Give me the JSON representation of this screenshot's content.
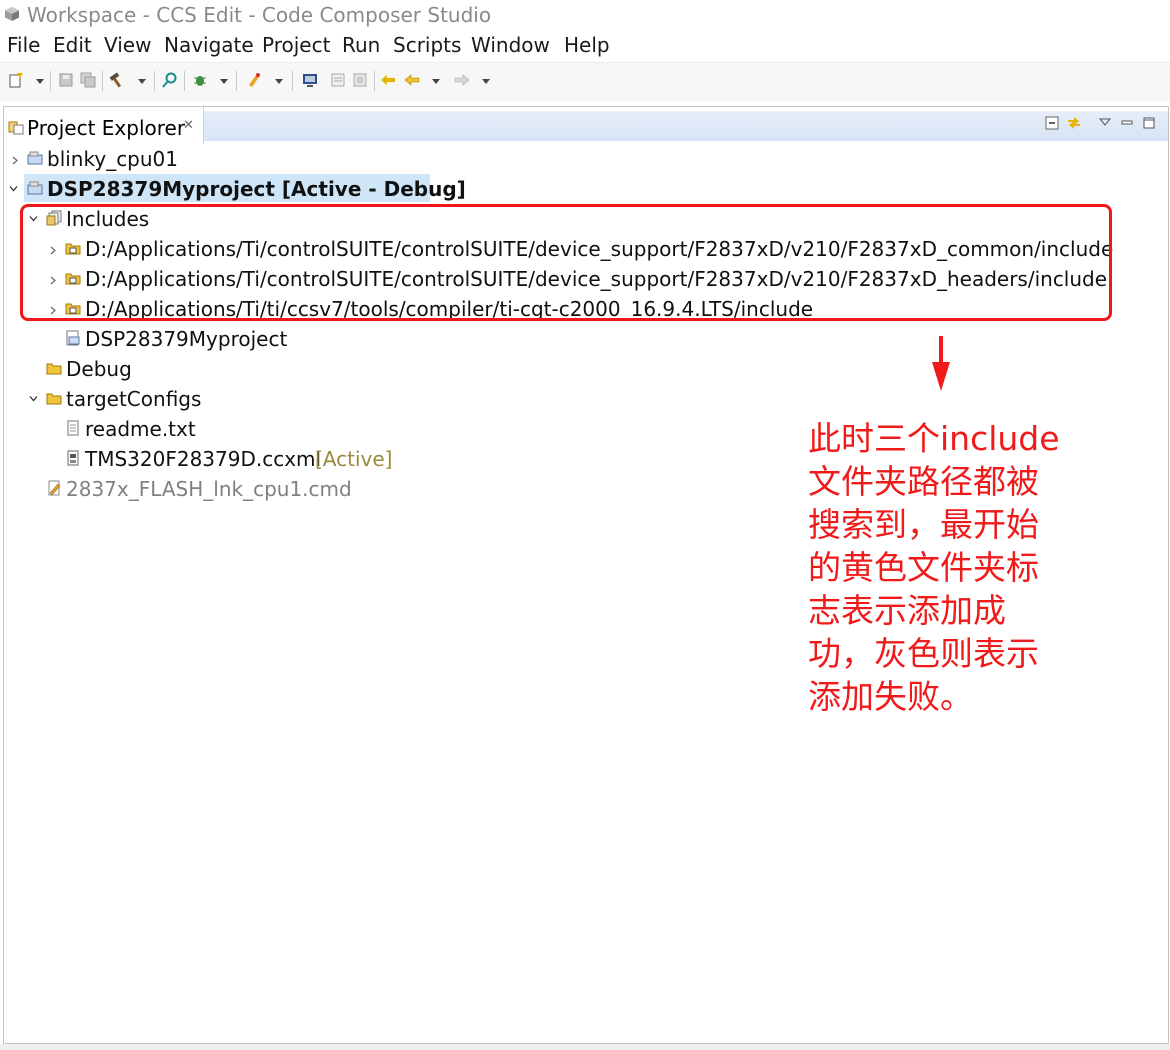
{
  "window": {
    "title": "Workspace - CCS Edit - Code Composer Studio"
  },
  "menubar": {
    "items": [
      "File",
      "Edit",
      "View",
      "Navigate",
      "Project",
      "Run",
      "Scripts",
      "Window",
      "Help"
    ]
  },
  "panel": {
    "tab_label": "Project Explorer",
    "close_glyph": "✕"
  },
  "tree": {
    "blinky": "blinky_cpu01",
    "project": "DSP28379Myproject  [Active - Debug]",
    "includes": "Includes",
    "include_paths": [
      "D:/Applications/Ti/controlSUITE/controlSUITE/device_support/F2837xD/v210/F2837xD_common/include",
      "D:/Applications/Ti/controlSUITE/controlSUITE/device_support/F2837xD/v210/F2837xD_headers/include",
      "D:/Applications/Ti/ti/ccsv7/tools/compiler/ti-cgt-c2000_16.9.4.LTS/include"
    ],
    "binary": "DSP28379Myproject",
    "debug": "Debug",
    "target_configs": "targetConfigs",
    "readme": "readme.txt",
    "ccxml": "TMS320F28379D.ccxml",
    "ccxml_status": "[Active]",
    "cmd": "2837x_FLASH_lnk_cpu1.cmd"
  },
  "annotation": {
    "lines": [
      "此时三个include",
      "文件夹路径都被",
      "搜索到，最开始",
      "的黄色文件夹标",
      "志表示添加成",
      "功，灰色则表示",
      "添加失败。"
    ],
    "color": "#f01a1a"
  }
}
